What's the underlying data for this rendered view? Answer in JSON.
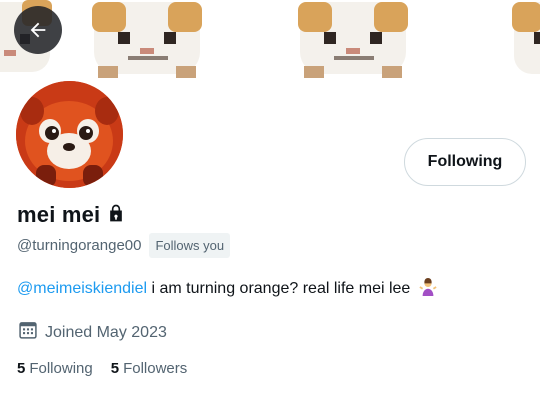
{
  "header": {
    "back_icon": "arrow-left-icon",
    "banner_art": "pixel-hamster-pattern"
  },
  "profile": {
    "avatar_icon": "red-panda-avatar",
    "follow_button_label": "Following",
    "display_name": "mei mei",
    "lock_icon": "lock-icon",
    "handle": "@turningorange00",
    "follows_you_badge": "Follows you",
    "bio_mention": "@meimeiskiendiel",
    "bio_text": " i am turning orange? real life mei lee",
    "bio_emoji": "person-shrugging-emoji",
    "joined_icon": "calendar-icon",
    "joined_text": "Joined May 2023",
    "following_count": "5",
    "following_label": "Following",
    "followers_count": "5",
    "followers_label": "Followers"
  },
  "colors": {
    "accent": "#1d9bf0",
    "secondary_text": "#536471",
    "primary_text": "#0f1419",
    "avatar_red": "#d84a1f"
  }
}
